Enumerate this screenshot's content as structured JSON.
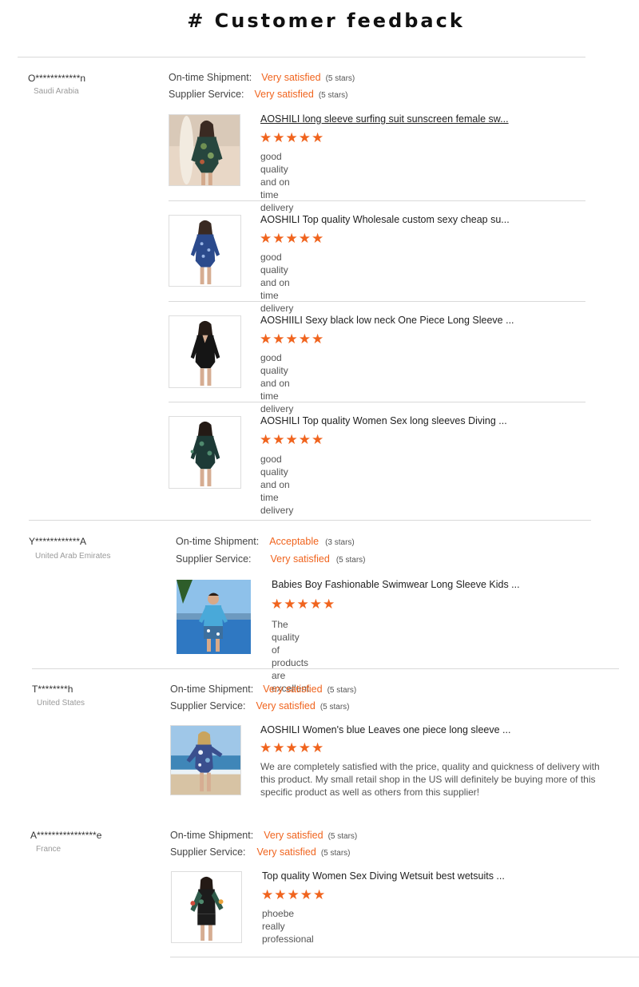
{
  "header": {
    "title": "# Customer feedback"
  },
  "labels": {
    "shipment": "On-time Shipment:",
    "service": "Supplier Service:"
  },
  "star_glyphs": "★★★★★",
  "reviews": [
    {
      "buyer": "O************n",
      "country": "Saudi Arabia",
      "shipment": {
        "value": "Very satisfied",
        "stars": "(5 stars)"
      },
      "service": {
        "value": "Very satisfied",
        "stars": "(5 stars)"
      },
      "products": [
        {
          "title": "AOSHILI long sleeve surfing suit sunscreen female sw...",
          "rating": 5,
          "comment": "good quality and on time delivery"
        },
        {
          "title": "AOSHILI Top quality Wholesale custom sexy cheap su...",
          "rating": 5,
          "comment": "good quality and on time delivery"
        },
        {
          "title": "AOSHIILI Sexy black low neck One Piece Long Sleeve ...",
          "rating": 5,
          "comment": "good quality and on time delivery"
        },
        {
          "title": "AOSHILI Top quality Women Sex long sleeves Diving ...",
          "rating": 5,
          "comment": "good quality and on time delivery"
        }
      ]
    },
    {
      "buyer": "Y************A",
      "country": "United Arab Emirates",
      "shipment": {
        "value": "Acceptable",
        "stars": "(3 stars)"
      },
      "service": {
        "value": "Very satisfied",
        "stars": "(5 stars)"
      },
      "products": [
        {
          "title": "Babies Boy Fashionable Swimwear Long Sleeve Kids ...",
          "rating": 5,
          "comment": "The quality of products are excellent"
        }
      ]
    },
    {
      "buyer": "T********h",
      "country": "United States",
      "shipment": {
        "value": "Very satisfied",
        "stars": "(5 stars)"
      },
      "service": {
        "value": "Very satisfied",
        "stars": "(5 stars)"
      },
      "products": [
        {
          "title": "AOSHILI Women's blue Leaves one piece long sleeve ...",
          "rating": 5,
          "comment": "We are completely satisfied with the price, quality and quickness of delivery with this product. My small retail shop in the US will definitely be buying more of this specific product as well as others from this supplier!"
        }
      ]
    },
    {
      "buyer": "A****************e",
      "country": "France",
      "shipment": {
        "value": "Very satisfied",
        "stars": "(5 stars)"
      },
      "service": {
        "value": "Very satisfied",
        "stars": "(5 stars)"
      },
      "products": [
        {
          "title": "Top quality Women Sex Diving Wetsuit best wetsuits ...",
          "rating": 5,
          "comment": "phoebe really professional"
        }
      ]
    }
  ],
  "colors": {
    "accent": "#f0641e",
    "divider": "#d9d9d9"
  }
}
